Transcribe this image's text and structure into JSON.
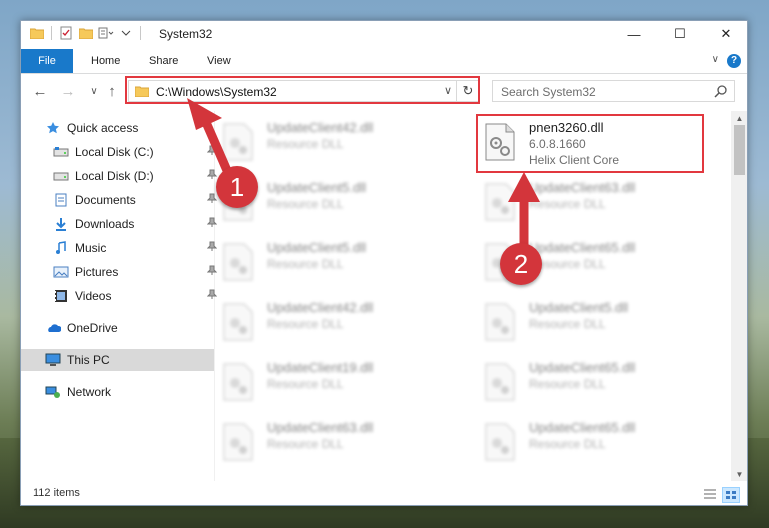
{
  "window": {
    "title": "System32",
    "minimize_glyph": "—",
    "maximize_glyph": "☐",
    "close_glyph": "✕"
  },
  "ribbon": {
    "tabs": [
      {
        "label": "File"
      },
      {
        "label": "Home"
      },
      {
        "label": "Share"
      },
      {
        "label": "View"
      }
    ],
    "help_label": "?",
    "toggle_glyph": "∨"
  },
  "nav": {
    "back_glyph": "←",
    "forward_glyph": "→",
    "recent_glyph": "∨",
    "up_glyph": "↑",
    "address": "C:\\Windows\\System32",
    "address_dropdown": "∨",
    "refresh_glyph": "↻",
    "search_placeholder": "Search System32"
  },
  "sidebar": {
    "items": [
      {
        "label": "Quick access",
        "icon": "star-icon"
      },
      {
        "label": "Local Disk (C:)",
        "icon": "drive-icon",
        "pinned": true
      },
      {
        "label": "Local Disk (D:)",
        "icon": "drive-icon",
        "pinned": true
      },
      {
        "label": "Documents",
        "icon": "documents-icon",
        "pinned": true
      },
      {
        "label": "Downloads",
        "icon": "downloads-icon",
        "pinned": true
      },
      {
        "label": "Music",
        "icon": "music-icon",
        "pinned": true
      },
      {
        "label": "Pictures",
        "icon": "pictures-icon",
        "pinned": true
      },
      {
        "label": "Videos",
        "icon": "videos-icon",
        "pinned": true
      },
      {
        "label": "OneDrive",
        "icon": "onedrive-icon"
      },
      {
        "label": "This PC",
        "icon": "this-pc-icon"
      },
      {
        "label": "Network",
        "icon": "network-icon"
      }
    ],
    "pin_glyph": "📌"
  },
  "files": {
    "left_column": [
      {
        "name": "UpdateClient42.dll",
        "type": "Resource DLL"
      },
      {
        "name": "UpdateClient5.dll",
        "type": "Resource DLL"
      },
      {
        "name": "UpdateClient5.dll",
        "type": "Resource DLL"
      },
      {
        "name": "UpdateClient42.dll",
        "type": "Resource DLL"
      },
      {
        "name": "UpdateClient19.dll",
        "type": "Resource DLL"
      },
      {
        "name": "UpdateClient63.dll",
        "type": "Resource DLL"
      }
    ],
    "highlighted": {
      "name": "pnen3260.dll",
      "version": "6.0.8.1660",
      "description": "Helix Client Core"
    },
    "right_column": [
      {
        "name": "UpdateClient63.dll",
        "type": "Resource DLL"
      },
      {
        "name": "UpdateClient65.dll",
        "type": "Resource DLL"
      },
      {
        "name": "UpdateClient5.dll",
        "type": "Resource DLL"
      },
      {
        "name": "UpdateClient65.dll",
        "type": "Resource DLL"
      },
      {
        "name": "UpdateClient65.dll",
        "type": "Resource DLL"
      }
    ]
  },
  "status": {
    "item_count": "112 items"
  },
  "annotations": {
    "step1": "1",
    "step2": "2",
    "color": "#d3353b"
  }
}
